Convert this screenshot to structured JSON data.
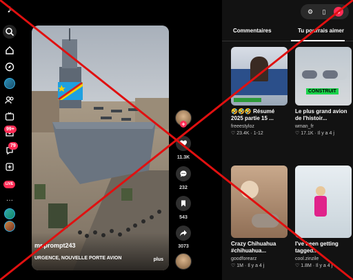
{
  "sidebar": {
    "logo_icon": "tiktok-logo-icon",
    "items": [
      {
        "name": "search-icon"
      },
      {
        "name": "home-icon"
      },
      {
        "name": "explore-icon"
      },
      {
        "name": "following-avatar"
      },
      {
        "name": "friends-icon"
      },
      {
        "name": "live-icon"
      },
      {
        "name": "inbox-icon",
        "badge": "99+"
      },
      {
        "name": "activity-icon",
        "badge": "79"
      },
      {
        "name": "upload-icon"
      },
      {
        "name": "live-studio-icon",
        "badge": "LIVE"
      },
      {
        "name": "more-icon"
      }
    ]
  },
  "video": {
    "username": "mr.prompt243",
    "caption": "URGENCE, NOUVELLE PORTE AVION",
    "more": "plus"
  },
  "actions": {
    "like_count": "11.3K",
    "comment_count": "232",
    "bookmark_count": "543",
    "share_count": "3073"
  },
  "panel": {
    "tabs": [
      "Commentaires",
      "Tu pourrais aimer"
    ],
    "recommendations": [
      {
        "title": "🤣🤣🤣 Résumé 2025 partie 15 ...",
        "author": "freeestyloz",
        "likes": "23.4K",
        "age": "1-12"
      },
      {
        "title": "Le plus grand avion de l'histoir...",
        "author": "wman_fr",
        "likes": "17.1K",
        "age": "Il y a 4 j",
        "overlay": "CONSTRUIT"
      },
      {
        "title": "Crazy Chihuahua #chihuahua...",
        "author": "goodforearz",
        "likes": "1M",
        "age": "Il y a 4 j"
      },
      {
        "title": "I've been getting tagged...",
        "author": "cool.zinzile",
        "likes": "1.8M",
        "age": "Il y a 4 j"
      }
    ]
  },
  "colors": {
    "accent": "#fe2c55",
    "overlay_x": "#e01010"
  }
}
